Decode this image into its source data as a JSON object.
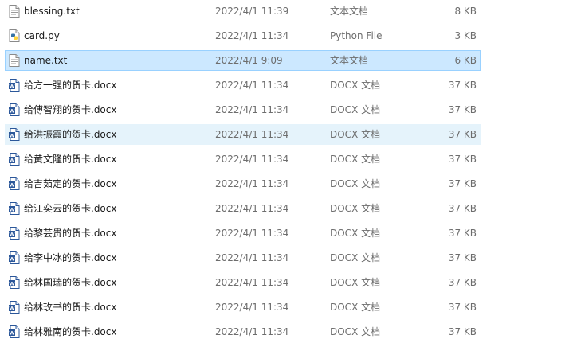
{
  "files": [
    {
      "name": "blessing.txt",
      "date": "2022/4/1 11:39",
      "type": "文本文档",
      "size": "8 KB",
      "icon": "text-file-icon",
      "state": "normal"
    },
    {
      "name": "card.py",
      "date": "2022/4/1 11:34",
      "type": "Python File",
      "size": "3 KB",
      "icon": "python-file-icon",
      "state": "normal"
    },
    {
      "name": "name.txt",
      "date": "2022/4/1 9:09",
      "type": "文本文档",
      "size": "6 KB",
      "icon": "text-file-icon",
      "state": "selected"
    },
    {
      "name": "给方一强的贺卡.docx",
      "date": "2022/4/1 11:34",
      "type": "DOCX 文档",
      "size": "37 KB",
      "icon": "word-doc-icon",
      "state": "normal"
    },
    {
      "name": "给傅智翔的贺卡.docx",
      "date": "2022/4/1 11:34",
      "type": "DOCX 文档",
      "size": "37 KB",
      "icon": "word-doc-icon",
      "state": "normal"
    },
    {
      "name": "给洪振霞的贺卡.docx",
      "date": "2022/4/1 11:34",
      "type": "DOCX 文档",
      "size": "37 KB",
      "icon": "word-doc-icon",
      "state": "hover"
    },
    {
      "name": "给黄文隆的贺卡.docx",
      "date": "2022/4/1 11:34",
      "type": "DOCX 文档",
      "size": "37 KB",
      "icon": "word-doc-icon",
      "state": "normal"
    },
    {
      "name": "给吉茹定的贺卡.docx",
      "date": "2022/4/1 11:34",
      "type": "DOCX 文档",
      "size": "37 KB",
      "icon": "word-doc-icon",
      "state": "normal"
    },
    {
      "name": "给江奕云的贺卡.docx",
      "date": "2022/4/1 11:34",
      "type": "DOCX 文档",
      "size": "37 KB",
      "icon": "word-doc-icon",
      "state": "normal"
    },
    {
      "name": "给黎芸贵的贺卡.docx",
      "date": "2022/4/1 11:34",
      "type": "DOCX 文档",
      "size": "37 KB",
      "icon": "word-doc-icon",
      "state": "normal"
    },
    {
      "name": "给李中冰的贺卡.docx",
      "date": "2022/4/1 11:34",
      "type": "DOCX 文档",
      "size": "37 KB",
      "icon": "word-doc-icon",
      "state": "normal"
    },
    {
      "name": "给林国瑞的贺卡.docx",
      "date": "2022/4/1 11:34",
      "type": "DOCX 文档",
      "size": "37 KB",
      "icon": "word-doc-icon",
      "state": "normal"
    },
    {
      "name": "给林玫书的贺卡.docx",
      "date": "2022/4/1 11:34",
      "type": "DOCX 文档",
      "size": "37 KB",
      "icon": "word-doc-icon",
      "state": "normal"
    },
    {
      "name": "给林雅南的贺卡.docx",
      "date": "2022/4/1 11:34",
      "type": "DOCX 文档",
      "size": "37 KB",
      "icon": "word-doc-icon",
      "state": "normal"
    }
  ],
  "colors": {
    "selected_bg": "#cce8ff",
    "selected_border": "#99d1ff",
    "hover_bg": "#e5f3fb",
    "word_blue": "#2b579a",
    "python_blue": "#3572a5",
    "python_yellow": "#ffd43b"
  }
}
